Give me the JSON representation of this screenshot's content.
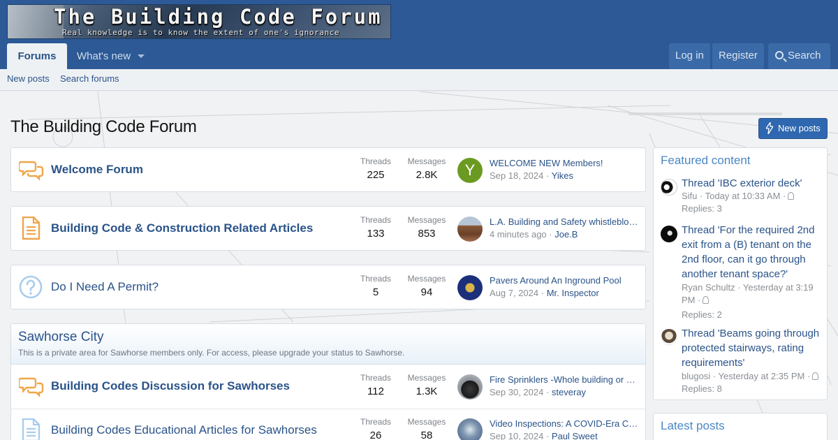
{
  "site": {
    "logo_title": "The Building Code Forum",
    "logo_tagline": "Real knowledge is to know the extent of one's ignorance"
  },
  "nav": {
    "tabs": [
      {
        "label": "Forums"
      },
      {
        "label": "What's new"
      }
    ],
    "login": "Log in",
    "register": "Register",
    "search": "Search"
  },
  "subnav": {
    "items": [
      {
        "label": "New posts"
      },
      {
        "label": "Search forums"
      }
    ]
  },
  "page": {
    "title": "The Building Code Forum",
    "new_posts_button": "New posts"
  },
  "labels": {
    "threads": "Threads",
    "messages": "Messages"
  },
  "forums": [
    {
      "title": "Welcome Forum",
      "icon": "chat-bubbles-icon",
      "threads": "225",
      "messages": "2.8K",
      "last_title": "WELCOME NEW Members!",
      "last_date": "Sep 18, 2024",
      "last_user": "Yikes",
      "avatar_letter": "Y",
      "avatar_color": "#6b9a22"
    },
    {
      "title": "Building Code & Construction Related Articles",
      "icon": "document-icon",
      "threads": "133",
      "messages": "853",
      "last_title": "L.A. Building and Safety whistleblower...",
      "last_date": "4 minutes ago",
      "last_user": "Joe.B"
    },
    {
      "title": "Do I Need A Permit?",
      "icon": "question-circle-icon",
      "threads": "5",
      "messages": "94",
      "last_title": "Pavers Around An Inground Pool",
      "last_date": "Aug 7, 2024",
      "last_user": "Mr. Inspector"
    }
  ],
  "category": {
    "title": "Sawhorse City",
    "description": "This is a private area for Sawhorse members only. For access, please upgrade your status to Sawhorse.",
    "forums": [
      {
        "title": "Building Codes Discussion for Sawhorses",
        "icon": "chat-bubbles-icon",
        "threads": "112",
        "messages": "1.3K",
        "last_title": "Fire Sprinklers -Whole building or Partial",
        "last_date": "Sep 30, 2024",
        "last_user": "steveray"
      },
      {
        "title": "Building Codes Educational Articles for Sawhorses",
        "icon": "document-icon",
        "threads": "26",
        "messages": "58",
        "last_title": "Video Inspections: A COVID-Era Convenience",
        "last_date": "Sep 10, 2024",
        "last_user": "Paul Sweet"
      }
    ]
  },
  "sidebar": {
    "featured_title": "Featured content",
    "featured": [
      {
        "title": "Thread 'IBC exterior deck'",
        "meta": "Sifu · Today at 10:33 AM ·",
        "replies": "Replies: 3"
      },
      {
        "title": "Thread 'For the required 2nd exit from a (B) tenant on the 2nd floor, can it go through another tenant space?'",
        "meta": "Ryan Schultz · Yesterday at 3:19 PM ·",
        "replies": "Replies: 2"
      },
      {
        "title": "Thread 'Beams going through protected stairways, rating requirements'",
        "meta": "blugosi · Yesterday at 2:35 PM ·",
        "replies": "Replies: 8"
      }
    ],
    "latest_title": "Latest posts"
  },
  "colors": {
    "header": "#2d5a96",
    "link": "#2a5389",
    "accent_orange": "#f0a54a",
    "accent_blue": "#a9cdee"
  }
}
